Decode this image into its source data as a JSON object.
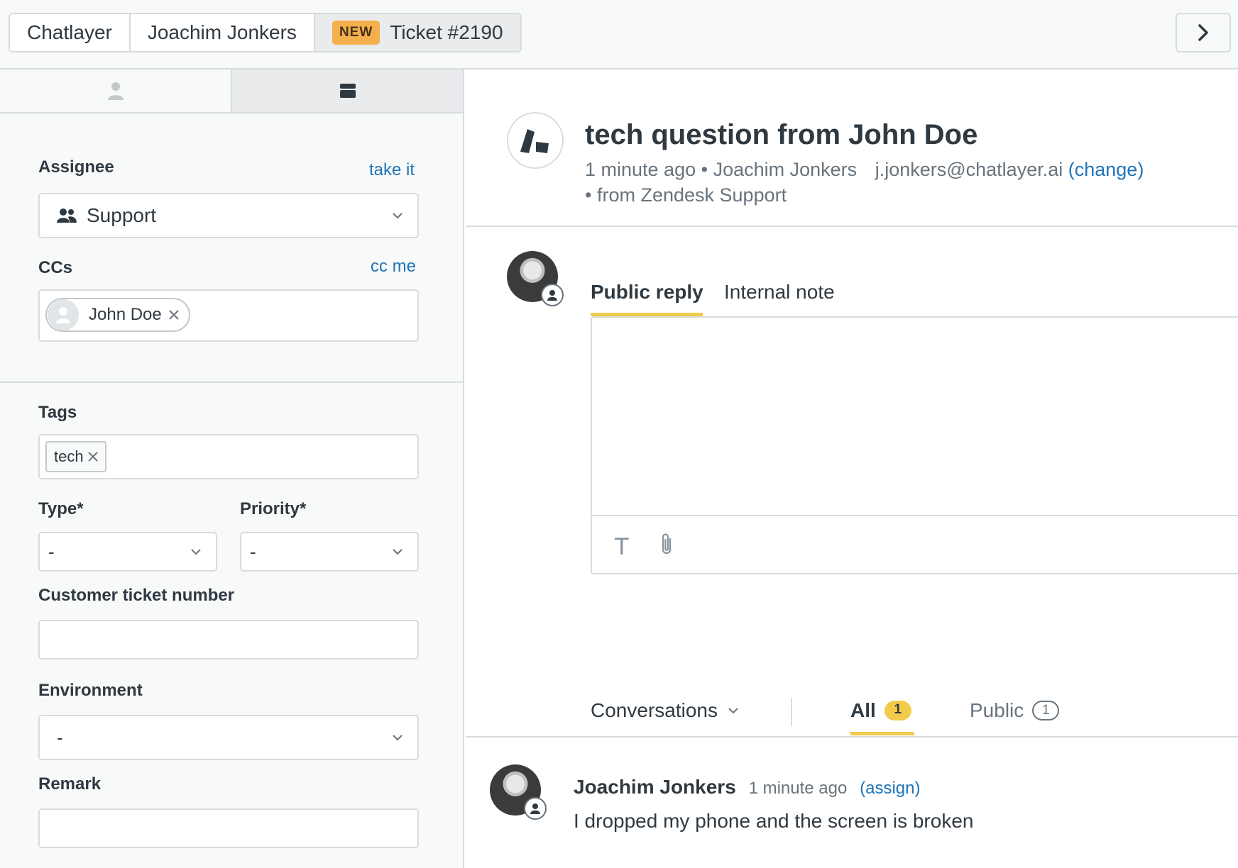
{
  "topbar": {
    "crumbs": [
      "Chatlayer",
      "Joachim Jonkers"
    ],
    "ticket_badge": "NEW",
    "ticket_label": "Ticket #2190"
  },
  "sidebar": {
    "assignee_label": "Assignee",
    "take_it": "take it",
    "assignee_value": "Support",
    "ccs_label": "CCs",
    "cc_me": "cc me",
    "cc_name": "John Doe",
    "tags_label": "Tags",
    "tag": "tech",
    "type_label": "Type*",
    "type_value": "-",
    "priority_label": "Priority*",
    "priority_value": "-",
    "customer_ticket_label": "Customer ticket number",
    "customer_ticket_value": "",
    "environment_label": "Environment",
    "environment_value": "-",
    "remark_label": "Remark",
    "remark_value": ""
  },
  "ticket": {
    "title": "tech question from John Doe",
    "time": "1 minute ago",
    "requester": "Joachim Jonkers",
    "email": "j.jonkers@chatlayer.ai",
    "change": "(change)",
    "source": "from Zendesk Support"
  },
  "editor": {
    "tab_public": "Public reply",
    "tab_internal": "Internal note",
    "text_tool": "T"
  },
  "conversations": {
    "filter_label": "Conversations",
    "tab_all": "All",
    "all_count": "1",
    "tab_public": "Public",
    "public_count": "1"
  },
  "message": {
    "author": "Joachim Jonkers",
    "time": "1 minute ago",
    "assign": "(assign)",
    "body": "I dropped my phone and the screen is broken"
  },
  "colors": {
    "accent_yellow": "#f3cb4b",
    "link_blue": "#1f73b7",
    "badge_orange": "#f3b04c"
  }
}
